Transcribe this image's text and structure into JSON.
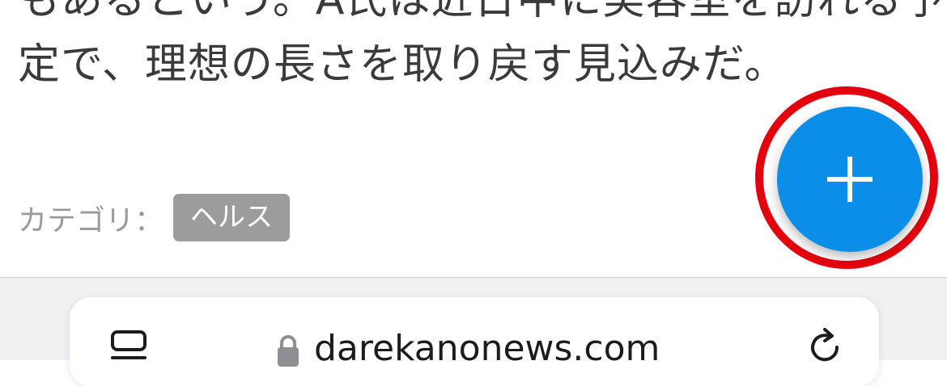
{
  "article": {
    "line_1": "もあるという。A氏は近日中に美容室を訪れる予",
    "line_2": "定で、理想の長さを取り戻す見込みだ。",
    "category_label": "カテゴリ：",
    "category_tag": "ヘルス"
  },
  "fab": {
    "icon": "plus-icon",
    "color": "#0a8ee8",
    "highlight_color": "#e3000f"
  },
  "browser": {
    "url": "darekanonews.com",
    "tabs_icon": "tabs-icon",
    "lock_icon": "lock-icon",
    "reload_icon": "reload-icon"
  }
}
